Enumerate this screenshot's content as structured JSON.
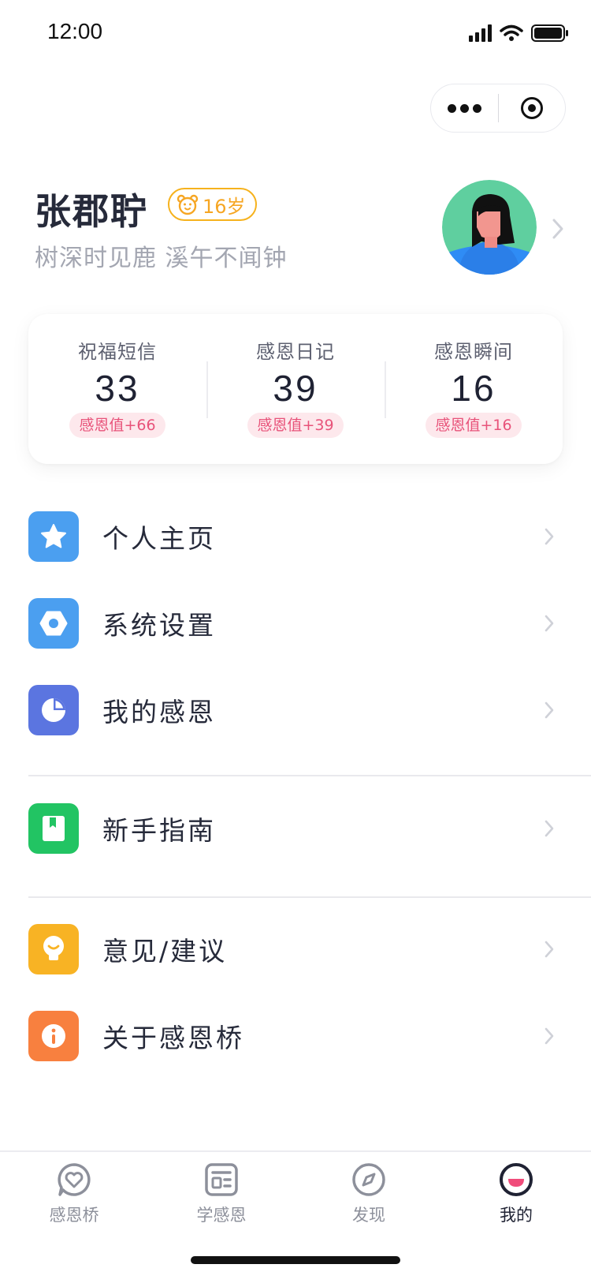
{
  "status_bar": {
    "time": "12:00"
  },
  "profile": {
    "name": "张郡聍",
    "age": "16岁",
    "bio": "树深时见鹿 溪午不闻钟"
  },
  "stats": [
    {
      "label": "祝福短信",
      "value": "33",
      "badge": "感恩值+66"
    },
    {
      "label": "感恩日记",
      "value": "39",
      "badge": "感恩值+39"
    },
    {
      "label": "感恩瞬间",
      "value": "16",
      "badge": "感恩值+16"
    }
  ],
  "menu": [
    {
      "label": "个人主页",
      "icon": "star-icon",
      "color": "#4b9ff0"
    },
    {
      "label": "系统设置",
      "icon": "hexagon-settings-icon",
      "color": "#4b9ff0"
    },
    {
      "label": "我的感恩",
      "icon": "pie-chart-icon",
      "color": "#5b75e0"
    },
    {
      "label": "新手指南",
      "icon": "book-icon",
      "color": "#22c463"
    },
    {
      "label": "意见/建议",
      "icon": "lightbulb-icon",
      "color": "#f8b324"
    },
    {
      "label": "关于感恩桥",
      "icon": "info-icon",
      "color": "#f8803f"
    }
  ],
  "tabs": [
    {
      "label": "感恩桥",
      "icon": "heart-chat-icon",
      "active": false
    },
    {
      "label": "学感恩",
      "icon": "layout-icon",
      "active": false
    },
    {
      "label": "发现",
      "icon": "compass-icon",
      "active": false
    },
    {
      "label": "我的",
      "icon": "smile-icon",
      "active": true
    }
  ],
  "colors": {
    "accent_orange": "#f6a623",
    "badge_pink_text": "#e8537a",
    "badge_pink_bg": "#fde8ec"
  }
}
